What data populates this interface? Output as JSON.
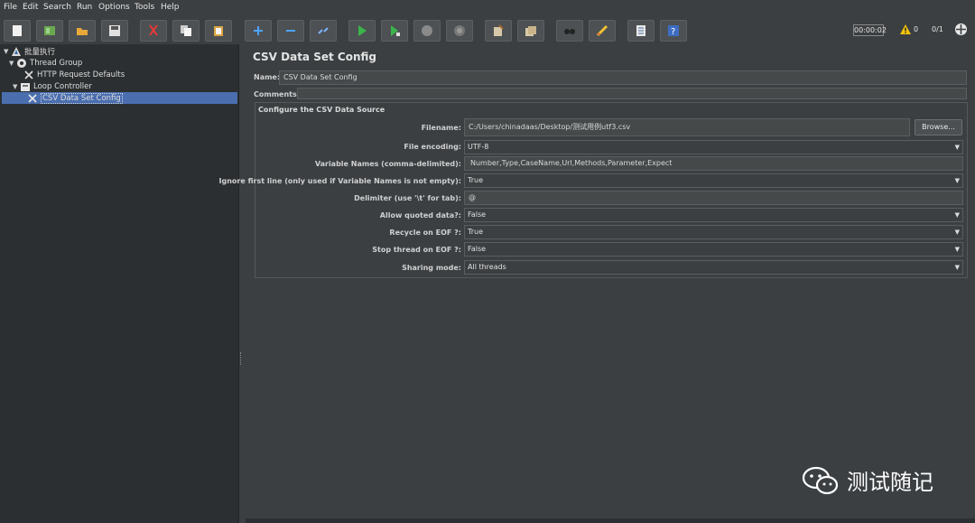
{
  "menu": [
    "File",
    "Edit",
    "Search",
    "Run",
    "Options",
    "Tools",
    "Help"
  ],
  "toolbar": {
    "buttons": [
      "new-icon",
      "templates-icon",
      "open-icon",
      "save-icon",
      "cut-icon",
      "copy-icon",
      "paste-icon",
      "expand-icon",
      "collapse-icon",
      "toggle-icon",
      "start-icon",
      "start-no-pauses-icon",
      "stop-icon",
      "shutdown-icon",
      "clear-icon",
      "clear-all-icon",
      "search-icon",
      "reset-search-icon",
      "function-helper-icon",
      "help-icon"
    ],
    "timer": "00:00:02",
    "warnings": "0",
    "threads": "0/1"
  },
  "tree": {
    "root": "批量执行",
    "thread_group": "Thread Group",
    "http_defaults": "HTTP Request Defaults",
    "loop_controller": "Loop Controller",
    "csv_config": "CSV Data Set Config"
  },
  "panel": {
    "title": "CSV Data Set Config",
    "name_label": "Name:",
    "name_value": "CSV Data Set Config",
    "comments_label": "Comments:",
    "group_title": "Configure the CSV Data Source",
    "browse": "Browse...",
    "fields": {
      "filename": {
        "label": "Filename:",
        "value": "C:/Users/chinadaas/Desktop/测试用例utf3.csv"
      },
      "encoding": {
        "label": "File encoding:",
        "value": "UTF-8"
      },
      "varnames": {
        "label": "Variable Names (comma-delimited):",
        "value": "Number,Type,CaseName,Url,Methods,Parameter,Expect"
      },
      "ignore": {
        "label": "Ignore first line (only used if Variable Names is not empty):",
        "value": "True"
      },
      "delimiter": {
        "label": "Delimiter (use '\\t' for tab):",
        "value": "@"
      },
      "quoted": {
        "label": "Allow quoted data?:",
        "value": "False"
      },
      "recycle": {
        "label": "Recycle on EOF ?:",
        "value": "True"
      },
      "stop": {
        "label": "Stop thread on EOF ?:",
        "value": "False"
      },
      "sharing": {
        "label": "Sharing mode:",
        "value": "All threads"
      }
    }
  },
  "watermark": "测试随记"
}
